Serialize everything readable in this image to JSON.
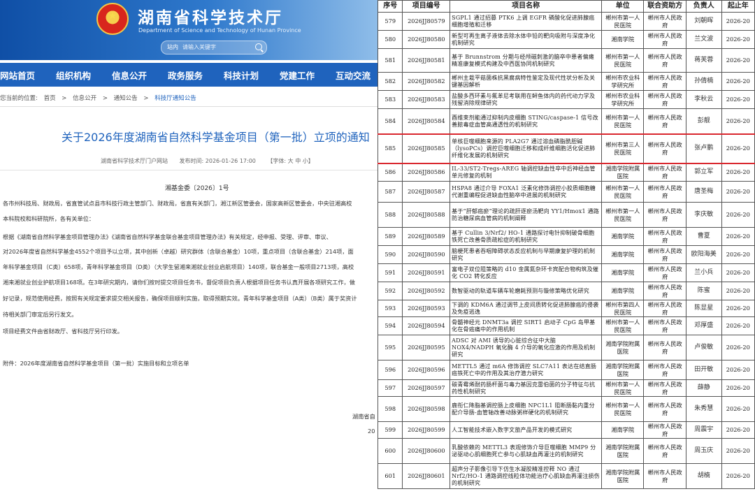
{
  "left": {
    "site_title": "湖南省科学技术厅",
    "site_subtitle": "Department of Science and Technology of Hunan Province",
    "search": {
      "label": "站内",
      "placeholder": "请输入关键字"
    },
    "nav": [
      "网站首页",
      "组织机构",
      "信息公开",
      "政务服务",
      "科技计划",
      "党建工作",
      "互动交流"
    ],
    "breadcrumb": [
      "您当前的位置:",
      "首页",
      ">",
      "信息公开",
      ">",
      "通知公告",
      ">",
      "科技厅通知公告"
    ],
    "doc_title": "关于2026年度湖南省自然科学基金项目（第一批）立项的通知",
    "meta": {
      "source": "湖南省科学技术厅门户网站",
      "date": "发布时间:  2026-01-26 17:00",
      "font": "【字体: 大 中 小】"
    },
    "doc_number": "湘基金委〔2026〕1号",
    "paragraphs": [
      "各市州科技局、财政局，省直管试点县市科技行政主管部门、财政局，省直有关部门，湘江新区管委会，国家高新区管委会，中央驻湘高校",
      "本科院校和科研院所，各有关单位：",
      "    根据《湖南省自然科学基金项目管理办法》《湖南省自然科学基金联合基金项目管理办法》有关规定，经申报、受理、评审、审议、",
      "对2026年度省自然科学基金4552个项目予以立项，其中创新（卓越）研究群体（含联合基金）10项，重点项目（含联合基金）214项，面",
      "年科学基金项目（C类）658项，青年科学基金项目（D类）（大学生留湘来湘就业创业启航项目）140项，联合基金一般项目2713项，高校",
      "湘来湘就业创业护航项目168项。在3年研究期内，请你们按时提交项目任务书，督促项目负责人根据项目任务书认真开展各项研究工作，做",
      "好记录，规范使用经费，按照有关规定要求提交相关报告，确保项目顺利实施，取得预期实效。青年科学基金项目（A类）（B类）属于奖资计",
      "待相关部门审定后另行发文。",
      "    项目经费文件由省财政厅、省科技厅另行印发。",
      "    附件：2026年度湖南省自然科学基金项目（第一批）实施目标和立项名单",
      "湖南省自",
      "20"
    ]
  },
  "right": {
    "headers": [
      "序号",
      "项目编号",
      "项目名称",
      "单位",
      "联合资助方",
      "负责人",
      "起止年"
    ],
    "rows": [
      {
        "no": "579",
        "code": "2026JJ80579",
        "name": "SGPL1 通过招募 PTK6 上调 EGFR 磷酸化促进肺腺癌细胞增殖和迁移",
        "unit": "郴州市第一人民医院",
        "funder": "郴州市人民政府",
        "leader": "刘朝晖",
        "year": "2026-20"
      },
      {
        "no": "580",
        "code": "2026JJ80580",
        "name": "新型可再生离子液体去除水体中铅的靶向吸附与深度净化机制研究",
        "unit": "湘南学院",
        "funder": "郴州市人民政府",
        "leader": "兰文波",
        "year": "2026-20"
      },
      {
        "no": "581",
        "code": "2026JJ80581",
        "name": "基于 Brunnstrom 分期与经颅磁刺激的脑卒中患者偏瘫精准康复模式构建及中西医协同机制研究",
        "unit": "郴州市第一人民医院",
        "funder": "郴州市人民政府",
        "leader": "蒋芙蓉",
        "year": "2026-20"
      },
      {
        "no": "582",
        "code": "2026JJ80582",
        "name": "郴州主栽平菇菌株抗黑腐病特性鉴定及现代性状分析及关键基因解析",
        "unit": "郴州市农业科学研究所",
        "funder": "郴州市人民政府",
        "leader": "孙倩楠",
        "year": "2026-20"
      },
      {
        "no": "583",
        "code": "2026JJ80583",
        "name": "盐酸多西环素与氟苯尼考联用在鲟鱼体内的药代动力学及残留消除规律研究",
        "unit": "郴州市农业科学研究所",
        "funder": "郴州市人民政府",
        "leader": "李秋云",
        "year": "2026-20"
      },
      {
        "no": "584",
        "code": "2026JJ80584",
        "name": "酉维束剂能通过抑制内皮细胞 STING/caspase-1 信号改善脓毒症血管高通透性的机制研究",
        "unit": "郴州市第一人民医院",
        "funder": "郴州市人民政府",
        "leader": "彭靓",
        "year": "2026-20"
      },
      {
        "no": "585",
        "code": "2026JJ80585",
        "name": "单核巨噬细胞来源的 PLA2G7 通过溶血磷脂酰胆碱（lysoPCs）调控巨噬细胞迁移和成纤维细胞活化促进肺纤维化发展的机制研究",
        "unit": "郴州市第三人民医院",
        "funder": "郴州市人民政府",
        "leader": "张卢鹏",
        "year": "2026-20"
      },
      {
        "no": "586",
        "code": "2026JJ80586",
        "name": "IL-33/ST2-Tregs-AREG 轴调控缺血性卒中后神经血管单元修复的机制",
        "unit": "湘南学院附属医院",
        "funder": "郴州市人民政府",
        "leader": "郭立军",
        "year": "2026-20"
      },
      {
        "no": "587",
        "code": "2026JJ80587",
        "name": "HSPA8 通过介导 FOXA1 泛素化修饰调控小胶质细胞糖代谢重编程促进缺血性脑卒中进展的机制研究",
        "unit": "郴州市第一人民医院",
        "funder": "郴州市人民政府",
        "leader": "唐圣梅",
        "year": "2026-20"
      },
      {
        "no": "588",
        "code": "2026JJ80588",
        "name": "基于“肝郁癌瘀”理论的疏肝逐瘀汤靶向 YY1/Hmox1 通路防治糖尿病血管病的机制阐释",
        "unit": "郴州市第一人民医院",
        "funder": "郴州市人民政府",
        "leader": "李庆敏",
        "year": "2026-20"
      },
      {
        "no": "589",
        "code": "2026JJ80589",
        "name": "基于 Cullin 3/Nrf2/ HO-1 通路探讨电针抑制破骨细胞铁死亡改善骨质疏松症的机制研究",
        "unit": "湘南学院",
        "funder": "郴州市人民政府",
        "leader": "曹夏",
        "year": "2026-20"
      },
      {
        "no": "590",
        "code": "2026JJ80590",
        "name": "脑梗死患者吞咽障碍状态反应机制与早期康复护理的机制研究",
        "unit": "湘南学院",
        "funder": "郴州市人民政府",
        "leader": "欧阳海美",
        "year": "2026-20"
      },
      {
        "no": "591",
        "code": "2026JJ80591",
        "name": "富电子双位阻策略的 d10 金属氮杂环卡宾配合物构筑及催化 CO2 转化反应",
        "unit": "湘南学院",
        "funder": "郴州市人民政府",
        "leader": "兰小兵",
        "year": "2026-20"
      },
      {
        "no": "592",
        "code": "2026JJ80592",
        "name": "数智驱动的轨道车辆车轮磨耗预测与镟修策略优化研究",
        "unit": "湘南学院",
        "funder": "郴州市人民政府",
        "leader": "陈蜜",
        "year": "2026-20"
      },
      {
        "no": "593",
        "code": "2026JJ80593",
        "name": "下调的 KDM6A 通过调节上皮间质转化促进肺腺癌的侵袭及免疫逃逸",
        "unit": "郴州市第四人民医院",
        "funder": "郴州市人民政府",
        "leader": "陈显星",
        "year": "2026-20"
      },
      {
        "no": "594",
        "code": "2026JJ80594",
        "name": "骨髓神经元 DNMT3a 调控 SIRT1 启动子 CpG 岛甲基化在骨癌痛中的作用机制",
        "unit": "郴州市第一人民医院",
        "funder": "郴州市人民政府",
        "leader": "邓厚盛",
        "year": "2026-20"
      },
      {
        "no": "595",
        "code": "2026JJ80595",
        "name": "ADSC 对 AMI 诱导的心脏综合征中大脑 NOX4/NADPH 氧化酶 4 介导的氧化应激的作用及机制研究",
        "unit": "湘南学院附属医院",
        "funder": "郴州市人民政府",
        "leader": "卢俊敏",
        "year": "2026-20"
      },
      {
        "no": "596",
        "code": "2026JJ80596",
        "name": "METTL5 通过 m6A 修饰调控 SLC7A11 表达在结直肠癌铁死亡中的作用及其治疗潜力研究",
        "unit": "湘南学院附属医院",
        "funder": "郴州市人民政府",
        "leader": "田开敏",
        "year": "2026-20"
      },
      {
        "no": "597",
        "code": "2026JJ80597",
        "name": "碳青霉烯耐药肠杆菌与毒力基因克雷伯菌的分子特征与抗药性机制研究",
        "unit": "郴州市第一人民医院",
        "funder": "郴州市人民政府",
        "leader": "薛静",
        "year": "2026-20"
      },
      {
        "no": "598",
        "code": "2026JJ80598",
        "name": "鹿衔仁降脂基调控肠上皮细胞 NPC1L1 阻断肠黏内重分配介导肠-血管轴改善动脉粥样硬化的机制研究",
        "unit": "郴州市第一人民医院",
        "funder": "郴州市人民政府",
        "leader": "朱秀慧",
        "year": "2026-20"
      },
      {
        "no": "599",
        "code": "2026JJ80599",
        "name": "人工智能技术嵌入数字文旅产品开发的模式研究",
        "unit": "湘南学院",
        "funder": "郴州市人民政府",
        "leader": "周震宇",
        "year": "2026-20"
      },
      {
        "no": "600",
        "code": "2026JJ80600",
        "name": "乳酸依赖的 METTL3 表观修饰介导巨噬细胞 MMP9 分泌驱动心肌细胞死亡参与心肌缺血再灌注的机制研究",
        "unit": "湘南学院附属医院",
        "funder": "郴州市人民政府",
        "leader": "周玉庆",
        "year": "2026-20"
      },
      {
        "no": "601",
        "code": "2026JJ80601",
        "name": "超声分子影像引导下仿生水凝胶精准控释 NO 通过 Nrf2/HO-1 通路调控线粒体功能治疗心肌缺血再灌注损伤的机制研究",
        "unit": "湘南学院附属医院",
        "funder": "郴州市人民政府",
        "leader": "胡楠",
        "year": "2026-20"
      }
    ]
  },
  "colors": {
    "brand_blue": "#1f63bd",
    "highlight_red": "#d9272e"
  }
}
